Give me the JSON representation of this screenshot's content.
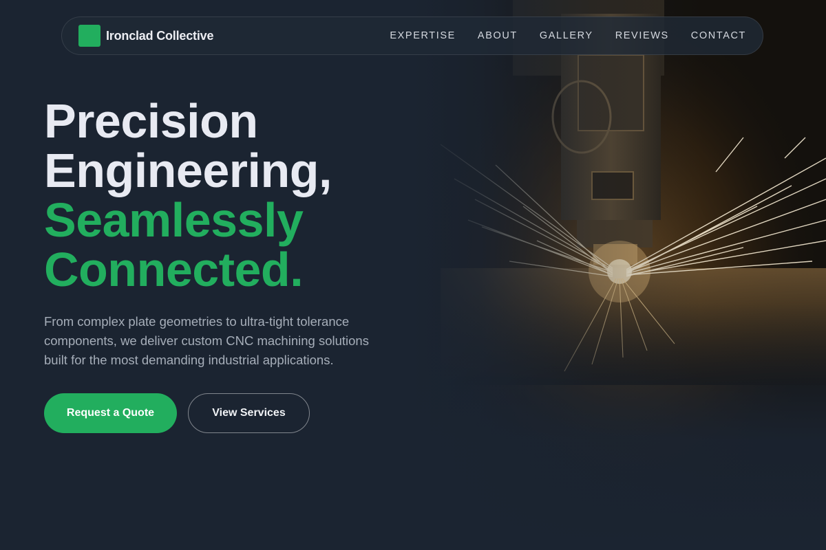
{
  "brand": {
    "name": "Ironclad Collective",
    "icon": "square-logo-icon",
    "color": "#22ae5e"
  },
  "nav": {
    "items": [
      {
        "label": "EXPERTISE"
      },
      {
        "label": "ABOUT"
      },
      {
        "label": "GALLERY"
      },
      {
        "label": "REVIEWS"
      },
      {
        "label": "CONTACT"
      }
    ]
  },
  "hero": {
    "headline_line1": "Precision",
    "headline_line2": "Engineering,",
    "headline_accent_line1": "Seamlessly",
    "headline_accent_line2": "Connected.",
    "lede": "From complex plate geometries to ultra-tight tolerance components, we deliver custom CNC machining solutions built for the most demanding industrial applications.",
    "primary_cta": "Request a Quote",
    "secondary_cta": "View Services",
    "background": "cnc-cutting-sparks-photo"
  },
  "colors": {
    "accent": "#22ae5e",
    "background": "#1b2431",
    "text": "#e8eaf2",
    "muted": "#a6aeb9"
  }
}
